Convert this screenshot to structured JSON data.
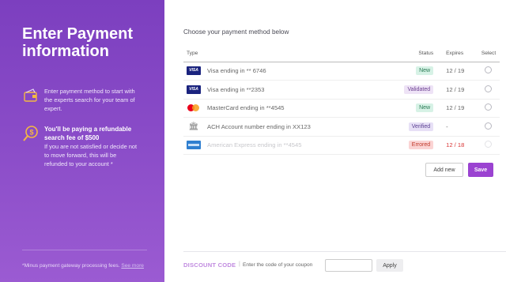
{
  "left": {
    "title": "Enter Payment information",
    "info1": {
      "text": "Enter payment method to start with the experts search for your team of expert."
    },
    "info2": {
      "heading": "You'll be paying a refundable search fee of $500",
      "text": "If you are not satisfied or decide not to move forward, this will be refunded to your account *"
    },
    "footnote": "*Minus payment gateway processing fees.",
    "footnote_link": "See more"
  },
  "right": {
    "prompt": "Choose your payment method below",
    "headers": {
      "type": "Type",
      "status": "Status",
      "expires": "Expires",
      "select": "Select"
    },
    "rows": [
      {
        "icon": "visa-icon",
        "name": "Visa ending in  ** 6746",
        "status": "New",
        "expires": "12 / 19"
      },
      {
        "icon": "visa-icon",
        "name": "Visa ending in  **2353",
        "status": "Validated",
        "expires": "12 / 19"
      },
      {
        "icon": "mastercard-icon",
        "name": "MasterCard ending in  **4545",
        "status": "New",
        "expires": "12 / 19"
      },
      {
        "icon": "bank-icon",
        "name": "ACH Account number ending in  XX123",
        "status": "Verified",
        "expires": "-"
      },
      {
        "icon": "amex-icon",
        "name": "American Express ending in  **4545",
        "status": "Errored",
        "expires": "12 / 18"
      }
    ],
    "visa_label": "VISA",
    "add_new": "Add new",
    "save": "Save",
    "discount_label": "DISCOUNT CODE",
    "discount_sep": "|",
    "discount_hint": "Enter the code of your coupon",
    "discount_value": "",
    "apply": "Apply"
  },
  "colors": {
    "accent": "#9b43d1",
    "left_panel": "#8a4cc8",
    "error": "#d93636"
  }
}
